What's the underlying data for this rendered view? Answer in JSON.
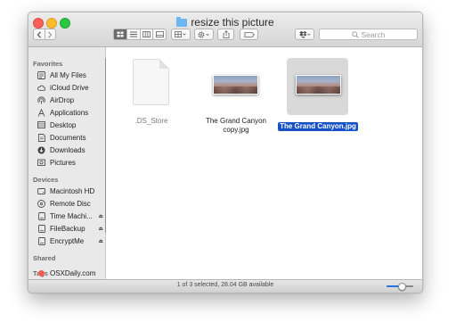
{
  "window": {
    "title": "resize this picture"
  },
  "toolbar": {
    "back_icon": "chevron-left-icon",
    "forward_icon": "chevron-right-icon",
    "view_modes": [
      "icon-view-icon",
      "list-view-icon",
      "column-view-icon",
      "cover-flow-icon"
    ],
    "arrange_icon": "arrange-grid-icon",
    "action_icon": "gear-icon",
    "share_icon": "share-icon",
    "tag_icon": "tag-icon",
    "dropbox_icon": "dropbox-icon",
    "search_placeholder": "Search"
  },
  "sidebar": {
    "sections": {
      "favorites": "Favorites",
      "devices": "Devices",
      "shared": "Shared",
      "tags": "Tags"
    },
    "favorites": [
      {
        "label": "All My Files",
        "icon": "all-files-icon"
      },
      {
        "label": "iCloud Drive",
        "icon": "cloud-icon"
      },
      {
        "label": "AirDrop",
        "icon": "airdrop-icon"
      },
      {
        "label": "Applications",
        "icon": "applications-icon"
      },
      {
        "label": "Desktop",
        "icon": "desktop-icon"
      },
      {
        "label": "Documents",
        "icon": "documents-icon"
      },
      {
        "label": "Downloads",
        "icon": "downloads-icon"
      },
      {
        "label": "Pictures",
        "icon": "pictures-icon"
      }
    ],
    "devices": [
      {
        "label": "Macintosh HD",
        "icon": "hard-drive-icon"
      },
      {
        "label": "Remote Disc",
        "icon": "disc-icon"
      },
      {
        "label": "Time Machi...",
        "icon": "drive-icon"
      },
      {
        "label": "FileBackup",
        "icon": "drive-icon"
      },
      {
        "label": "EncryptMe",
        "icon": "drive-icon"
      }
    ],
    "tags": [
      {
        "label": "OSXDaily.com",
        "color": "#f25c54"
      }
    ]
  },
  "files": [
    {
      "name": ".DS_Store",
      "selected": false
    },
    {
      "name_line1": "The Grand Canyon",
      "name_line2": "copy.jpg",
      "selected": false
    },
    {
      "name": "The Grand Canyon.jpg",
      "selected": true
    }
  ],
  "status": {
    "text": "1 of 3 selected, 28.04 GB available",
    "zoom_level": 0.55
  },
  "colors": {
    "selection": "#1651c6",
    "accent": "#2a72e0"
  }
}
